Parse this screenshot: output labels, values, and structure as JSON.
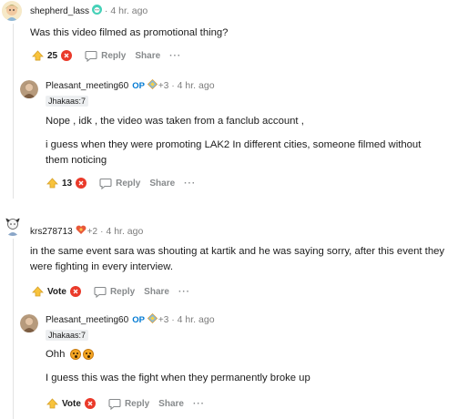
{
  "colors": {
    "downvote": "#ea3a2a",
    "op": "#0079d3",
    "muted": "#7c7c7c"
  },
  "comments": [
    {
      "username": "shepherd_lass",
      "time": "4 hr. ago",
      "body": [
        "Was this video filmed as promotional thing?"
      ],
      "votes": "25",
      "reply_label": "Reply",
      "share_label": "Share",
      "more_label": "···"
    },
    {
      "username": "Pleasant_meeting60",
      "op_label": "OP",
      "karma": "+3",
      "time": "4 hr. ago",
      "flair": "Jhakaas:7",
      "body": [
        "Nope , idk , the video was taken from a fanclub account ,",
        "i guess when they were promoting LAK2 In different cities, someone filmed without them noticing"
      ],
      "votes": "13",
      "reply_label": "Reply",
      "share_label": "Share",
      "more_label": "···"
    },
    {
      "username": "krs278713",
      "karma": "+2",
      "time": "4 hr. ago",
      "body": [
        "in the same event sara was shouting at kartik and he was saying sorry, after this event they were fighting in every interview."
      ],
      "votes": "Vote",
      "reply_label": "Reply",
      "share_label": "Share",
      "more_label": "···"
    },
    {
      "username": "Pleasant_meeting60",
      "op_label": "OP",
      "karma": "+3",
      "time": "4 hr. ago",
      "flair": "Jhakaas:7",
      "body": [
        "Ohh",
        "I guess this was the fight when they permanently broke up"
      ],
      "votes": "Vote",
      "reply_label": "Reply",
      "share_label": "Share",
      "more_label": "···"
    }
  ]
}
